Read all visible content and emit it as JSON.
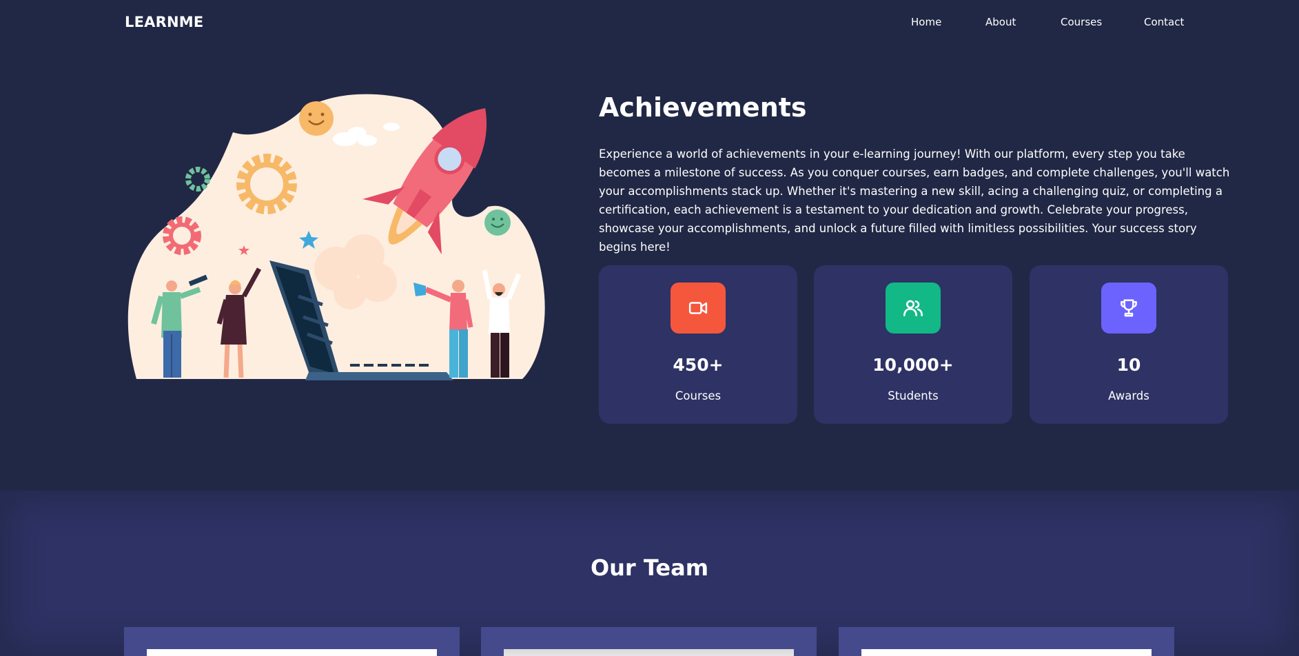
{
  "nav": {
    "logo": "LEARNME",
    "links": [
      {
        "label": "Home"
      },
      {
        "label": "About"
      },
      {
        "label": "Courses"
      },
      {
        "label": "Contact"
      }
    ]
  },
  "hero": {
    "title": "Achievements",
    "description": "Experience a world of achievements in your e-learning journey! With our platform, every step you take becomes a milestone of success. As you conquer courses, earn badges, and complete challenges, you'll watch your accomplishments stack up. Whether it's mastering a new skill, acing a challenging quiz, or completing a certification, each achievement is a testament to your dedication and growth. Celebrate your progress, showcase your accomplishments, and unlock a future filled with limitless possibilities. Your success story begins here!",
    "illustration_icon": "rocket-launch-illustration"
  },
  "stats": [
    {
      "value": "450+",
      "label": "Courses",
      "icon": "video-icon",
      "color": "#f5573d"
    },
    {
      "value": "10,000+",
      "label": "Students",
      "icon": "users-icon",
      "color": "#12b886"
    },
    {
      "value": "10",
      "label": "Awards",
      "icon": "trophy-icon",
      "color": "#6c63ff"
    }
  ],
  "team": {
    "title": "Our Team"
  },
  "colors": {
    "background": "#212845",
    "card": "#2e3264",
    "team_card": "#454a8c"
  }
}
